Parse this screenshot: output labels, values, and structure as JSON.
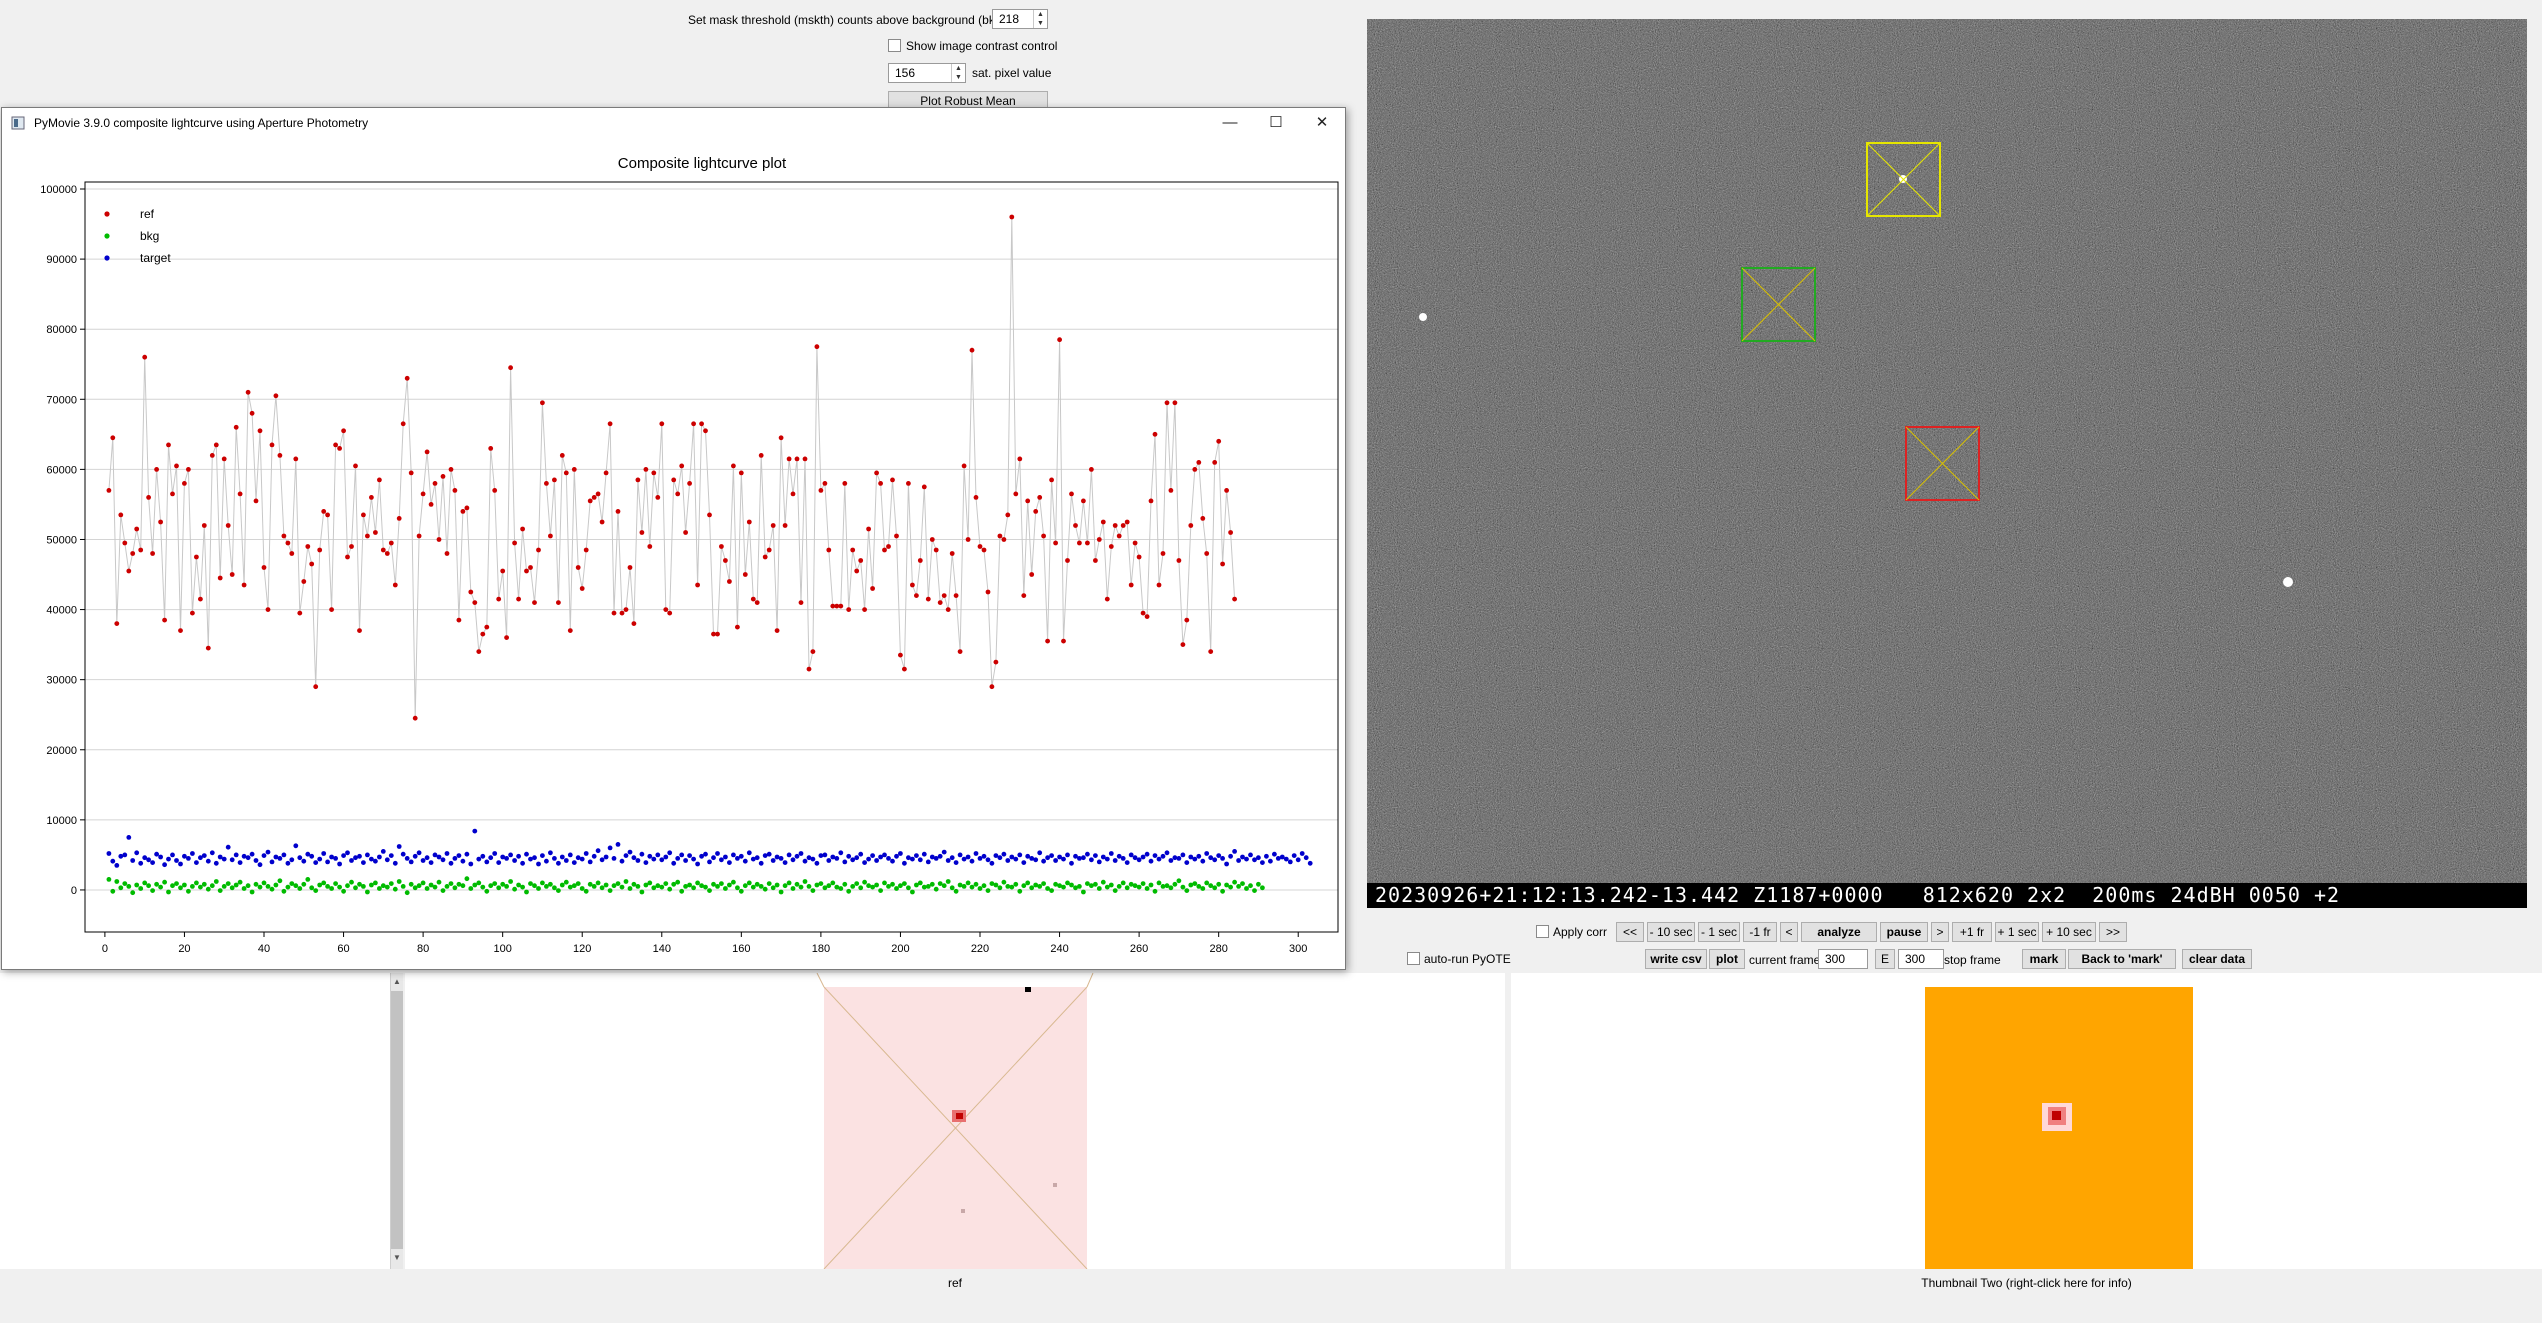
{
  "top_controls": {
    "mask_threshold_label": "Set mask threshold (mskth) counts above background (bkavg)",
    "mask_threshold_value": "218",
    "show_contrast_label": "Show image contrast control",
    "sat_pixel_value": "156",
    "sat_pixel_label": "sat. pixel value",
    "plot_robust_mean_label": "Plot Robust Mean"
  },
  "plot_window": {
    "title": "PyMovie 3.9.0 composite lightcurve using Aperture Photometry",
    "minimize_glyph": "—",
    "maximize_glyph": "☐",
    "close_glyph": "✕"
  },
  "chart_data": {
    "type": "scatter",
    "title": "Composite lightcurve plot",
    "xlabel": "",
    "ylabel": "",
    "xlim": [
      -5,
      310
    ],
    "ylim": [
      -6000,
      101000
    ],
    "x_ticks": [
      0,
      20,
      40,
      60,
      80,
      100,
      120,
      140,
      160,
      180,
      200,
      220,
      240,
      260,
      280,
      300
    ],
    "y_ticks": [
      0,
      10000,
      20000,
      30000,
      40000,
      50000,
      60000,
      70000,
      80000,
      90000,
      100000
    ],
    "grid": true,
    "legend_position": "top-left",
    "series": [
      {
        "name": "ref",
        "color": "#cc0000",
        "connected": true,
        "x_start": 1,
        "values": [
          57000,
          64500,
          38000,
          53500,
          49500,
          45500,
          48000,
          51500,
          48500,
          76000,
          56000,
          48000,
          60000,
          52500,
          38500,
          63500,
          56500,
          60500,
          37000,
          58000,
          60000,
          39500,
          47500,
          41500,
          52000,
          34500,
          62000,
          63500,
          44500,
          61500,
          52000,
          45000,
          66000,
          56500,
          43500,
          71000,
          68000,
          55500,
          65500,
          46000,
          40000,
          63500,
          70500,
          62000,
          50500,
          49500,
          48000,
          61500,
          39500,
          44000,
          49000,
          46500,
          29000,
          48500,
          54000,
          53500,
          40000,
          63500,
          63000,
          65500,
          47500,
          49000,
          60500,
          37000,
          53500,
          50500,
          56000,
          51000,
          58500,
          48500,
          48000,
          49500,
          43500,
          53000,
          66500,
          73000,
          59500,
          24500,
          50500,
          56500,
          62500,
          55000,
          58000,
          50000,
          59000,
          48000,
          60000,
          57000,
          38500,
          54000,
          54500,
          42500,
          41000,
          34000,
          36500,
          37500,
          63000,
          57000,
          41500,
          45500,
          36000,
          74500,
          49500,
          41500,
          51500,
          45500,
          46000,
          41000,
          48500,
          69500,
          58000,
          50500,
          58500,
          41000,
          62000,
          59500,
          37000,
          60000,
          46000,
          43000,
          48500,
          55500,
          56000,
          56500,
          52500,
          59500,
          66500,
          39500,
          54000,
          39500,
          40000,
          46000,
          38000,
          58500,
          51000,
          60000,
          49000,
          59500,
          56000,
          66500,
          40000,
          39500,
          58500,
          56500,
          60500,
          51000,
          58000,
          66500,
          43500,
          66500,
          65500,
          53500,
          36500,
          36500,
          49000,
          47000,
          44000,
          60500,
          37500,
          59500,
          45000,
          52500,
          41500,
          41000,
          62000,
          47500,
          48500,
          52000,
          37000,
          64500,
          52000,
          61500,
          56500,
          61500,
          41000,
          61500,
          31500,
          34000,
          77500,
          57000,
          58000,
          48500,
          40500,
          40500,
          40500,
          58000,
          40000,
          48500,
          45500,
          47000,
          40000,
          51500,
          43000,
          59500,
          58000,
          48500,
          49000,
          58500,
          50500,
          33500,
          31500,
          58000,
          43500,
          42000,
          47000,
          57500,
          41500,
          50000,
          48500,
          41000,
          42000,
          40000,
          48000,
          42000,
          34000,
          60500,
          50000,
          77000,
          56000,
          49000,
          48500,
          42500,
          29000,
          32500,
          50500,
          50000,
          53500,
          96000,
          56500,
          61500,
          42000,
          55500,
          45000,
          54000,
          56000,
          50500,
          35500,
          58500,
          49500,
          78500,
          35500,
          47000,
          56500,
          52000,
          49500,
          55500,
          49500,
          60000,
          47000,
          50000,
          52500,
          41500,
          49000,
          52000,
          50500,
          52000,
          52500,
          43500,
          49500,
          47500,
          39500,
          39000,
          55500,
          65000,
          43500,
          48000,
          69500,
          57000,
          69500,
          47000,
          35000,
          38500,
          52000,
          60000,
          61000,
          53000,
          48000,
          34000,
          61000,
          64000,
          46500,
          57000,
          51000,
          41500
        ]
      },
      {
        "name": "bkg",
        "color": "#00bb00",
        "connected": false,
        "x_start": 1,
        "values": [
          1500,
          -200,
          1200,
          300,
          900,
          500,
          -400,
          700,
          200,
          1000,
          600,
          -100,
          800,
          400,
          1100,
          -300,
          600,
          900,
          300,
          700,
          -200,
          500,
          1000,
          400,
          800,
          100,
          600,
          1200,
          -100,
          500,
          900,
          300,
          700,
          1100,
          200,
          600,
          -300,
          800,
          400,
          1000,
          500,
          100,
          700,
          1300,
          -200,
          400,
          900,
          600,
          200,
          800,
          1500,
          300,
          -100,
          700,
          1000,
          500,
          200,
          900,
          400,
          -200,
          600,
          1100,
          300,
          800,
          500,
          -300,
          700,
          1000,
          200,
          600,
          400,
          900,
          100,
          1200,
          500,
          -400,
          800,
          300,
          600,
          1000,
          200,
          700,
          400,
          1100,
          -100,
          500,
          900,
          300,
          800,
          600,
          1600,
          200,
          700,
          1000,
          400,
          -200,
          600,
          900,
          300,
          800,
          500,
          1200,
          100,
          700,
          400,
          -300,
          900,
          600,
          200,
          1000,
          500,
          800,
          300,
          -100,
          700,
          1100,
          400,
          600,
          900,
          200,
          -200,
          800,
          500,
          1000,
          300,
          700,
          -100,
          600,
          900,
          400,
          1200,
          200,
          800,
          500,
          -300,
          700,
          1000,
          300,
          600,
          400,
          900,
          100,
          800,
          1100,
          -200,
          500,
          700,
          300,
          1000,
          600,
          400,
          -100,
          800,
          500,
          900,
          200,
          700,
          1100,
          300,
          -200,
          600,
          1000,
          400,
          800,
          500,
          100,
          900,
          300,
          700,
          -300,
          600,
          1000,
          200,
          800,
          400,
          1200,
          500,
          -100,
          700,
          900,
          300,
          600,
          1000,
          400,
          200,
          800,
          -200,
          500,
          900,
          300,
          1100,
          600,
          400,
          700,
          -100,
          1000,
          500,
          800,
          200,
          600,
          900,
          300,
          -300,
          700,
          1000,
          400,
          500,
          800,
          100,
          900,
          600,
          1200,
          300,
          -200,
          700,
          500,
          1000,
          400,
          800,
          200,
          600,
          -100,
          900,
          700,
          300,
          1100,
          500,
          400,
          800,
          -200,
          600,
          1000,
          300,
          700,
          500,
          900,
          200,
          -100,
          800,
          600,
          400,
          1000,
          700,
          300,
          500,
          -300,
          900,
          600,
          800,
          200,
          1100,
          400,
          700,
          -100,
          500,
          1000,
          300,
          800,
          600,
          400,
          900,
          200,
          700,
          -200,
          1000,
          500,
          600,
          300,
          800,
          1300,
          400,
          -100,
          700,
          900,
          500,
          200,
          1000,
          600,
          300,
          800,
          -200,
          700,
          400,
          1100,
          500,
          900,
          200,
          600,
          -100,
          800,
          300
        ]
      },
      {
        "name": "target",
        "color": "#0000cc",
        "connected": false,
        "x_start": 1,
        "values": [
          5200,
          4100,
          3500,
          4800,
          5000,
          7500,
          4200,
          5300,
          3800,
          4600,
          4300,
          3900,
          5100,
          4700,
          3600,
          4400,
          5000,
          4200,
          3700,
          4800,
          4500,
          5200,
          3900,
          4600,
          4900,
          4100,
          5300,
          3800,
          4700,
          4400,
          6100,
          4300,
          5000,
          3900,
          4800,
          4600,
          5100,
          4200,
          3600,
          4900,
          5400,
          4000,
          4700,
          4500,
          5000,
          3800,
          4300,
          6300,
          4600,
          4100,
          5100,
          4800,
          3900,
          4400,
          5200,
          4000,
          4700,
          4500,
          3700,
          4900,
          5300,
          4200,
          4600,
          4800,
          3900,
          5000,
          4400,
          4100,
          4700,
          5500,
          4300,
          4900,
          3800,
          6200,
          5100,
          4500,
          4000,
          4800,
          5300,
          4200,
          4600,
          3900,
          5000,
          4700,
          4300,
          5200,
          3800,
          4500,
          4900,
          4100,
          5100,
          3700,
          8400,
          4400,
          4800,
          4000,
          4600,
          5200,
          3900,
          4700,
          4500,
          5000,
          4200,
          4800,
          3800,
          5100,
          4400,
          4600,
          3700,
          4900,
          4100,
          5300,
          4500,
          3800,
          4700,
          4200,
          5000,
          3900,
          4600,
          4400,
          5200,
          4000,
          4800,
          5600,
          4300,
          4700,
          6000,
          4500,
          6500,
          4100,
          4900,
          5400,
          4600,
          4200,
          5100,
          3900,
          4800,
          4400,
          5000,
          4300,
          4700,
          5300,
          3800,
          4500,
          5000,
          4200,
          4900,
          4400,
          3700,
          4800,
          5100,
          4000,
          4600,
          5200,
          4300,
          4700,
          3900,
          5000,
          4500,
          4800,
          4100,
          5300,
          4400,
          4600,
          3800,
          4900,
          5100,
          4200,
          4700,
          4500,
          3900,
          5000,
          4300,
          4800,
          5200,
          4100,
          4600,
          4400,
          3800,
          4900,
          5000,
          4200,
          4700,
          4500,
          5300,
          4000,
          4800,
          4300,
          4600,
          5100,
          3900,
          4400,
          4900,
          4200,
          4700,
          5000,
          4500,
          4100,
          4800,
          5200,
          3800,
          4600,
          4400,
          4900,
          4300,
          5100,
          4000,
          4700,
          4500,
          4800,
          5400,
          4200,
          4600,
          3900,
          5000,
          4400,
          4700,
          4100,
          5200,
          4500,
          4800,
          4300,
          3800,
          4900,
          4600,
          5100,
          4200,
          4700,
          4400,
          5000,
          3900,
          4800,
          4500,
          4300,
          5300,
          4100,
          4600,
          4900,
          4200,
          4700,
          4400,
          5000,
          3800,
          4800,
          4500,
          4600,
          5100,
          4300,
          4900,
          4000,
          4700,
          4400,
          5200,
          4200,
          4800,
          4500,
          3900,
          5000,
          4600,
          4300,
          4700,
          5100,
          4100,
          4900,
          4400,
          4800,
          5300,
          4200,
          4600,
          4500,
          5000,
          3900,
          4700,
          4400,
          4800,
          4100,
          5200,
          4600,
          4300,
          4900,
          4500,
          3700,
          4800,
          5500,
          4200,
          4700,
          4400,
          5000,
          4300,
          4600,
          3900,
          4800,
          4100,
          5100,
          4500,
          4700,
          4400,
          4000,
          4900,
          4300,
          5200,
          4600,
          3800
        ]
      }
    ]
  },
  "main_image": {
    "timestamp": "20230926+21:12:13.242-13.442 Z1187+0000   812x620 2x2  200ms 24dBH 0050 +2"
  },
  "controls": {
    "apply_corr": "Apply corr",
    "nav_buttons": [
      "<<",
      "- 10 sec",
      "- 1 sec",
      "-1 fr",
      "<",
      "analyze",
      "pause",
      ">",
      "+1 fr",
      "+ 1 sec",
      "+ 10 sec",
      ">>"
    ],
    "auto_run_pyote": "auto-run PyOTE",
    "write_csv": "write csv",
    "plot": "plot",
    "current_frame_label": "current frame:",
    "current_frame_value": "300",
    "e_label": "E",
    "stop_frame_value": "300",
    "stop_frame_label": "stop frame",
    "mark": "mark",
    "back_to_mark": "Back to 'mark'",
    "clear_data": "clear data"
  },
  "thumbnails": {
    "one_caption": "ref",
    "two_caption": "Thumbnail Two (right-click here for info)"
  },
  "colors": {
    "aperture_target": "#e6e600",
    "aperture_green": "#22aa22",
    "aperture_red": "#dd2222",
    "thumbnail_two_bg": "#ffa500"
  }
}
